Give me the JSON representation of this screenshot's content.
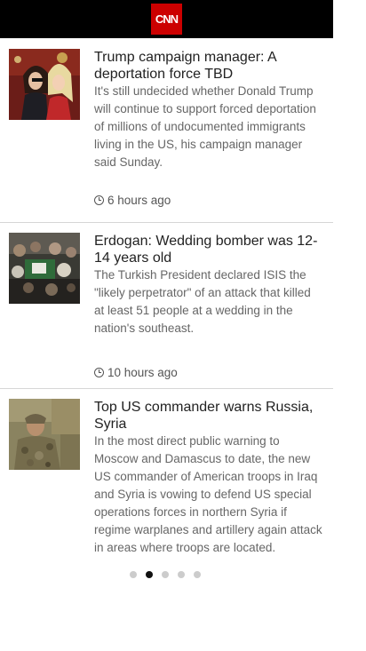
{
  "header": {
    "logo_text": "CNN",
    "logo_color": "#cc0000",
    "bar_color": "#000000"
  },
  "articles": [
    {
      "headline": "Trump campaign manager: A deportation force TBD",
      "summary": "It's still undecided whether Donald Trump will continue to support forced deportation of millions of undocumented immigrants living in the US, his campaign manager said Sunday.",
      "time": "6 hours ago",
      "thumbnail": "two women at a rally"
    },
    {
      "headline": "Erdogan: Wedding bomber was 12-14 years old",
      "summary": "The Turkish President declared ISIS the \"likely perpetrator\" of an attack that killed at least 51 people at a wedding in the nation's southeast.",
      "time": "10 hours ago",
      "thumbnail": "crowd at a funeral"
    },
    {
      "headline": "Top US commander warns Russia, Syria",
      "summary": "In the most direct public warning to Moscow and Damascus to date, the new US commander of American troops in Iraq and Syria is vowing to defend US special operations forces in northern Syria if regime warplanes and artillery again attack in areas where troops are located.",
      "thumbnail": "soldier in camouflage"
    }
  ],
  "pagination": {
    "pages": 5,
    "active_index": 1
  }
}
